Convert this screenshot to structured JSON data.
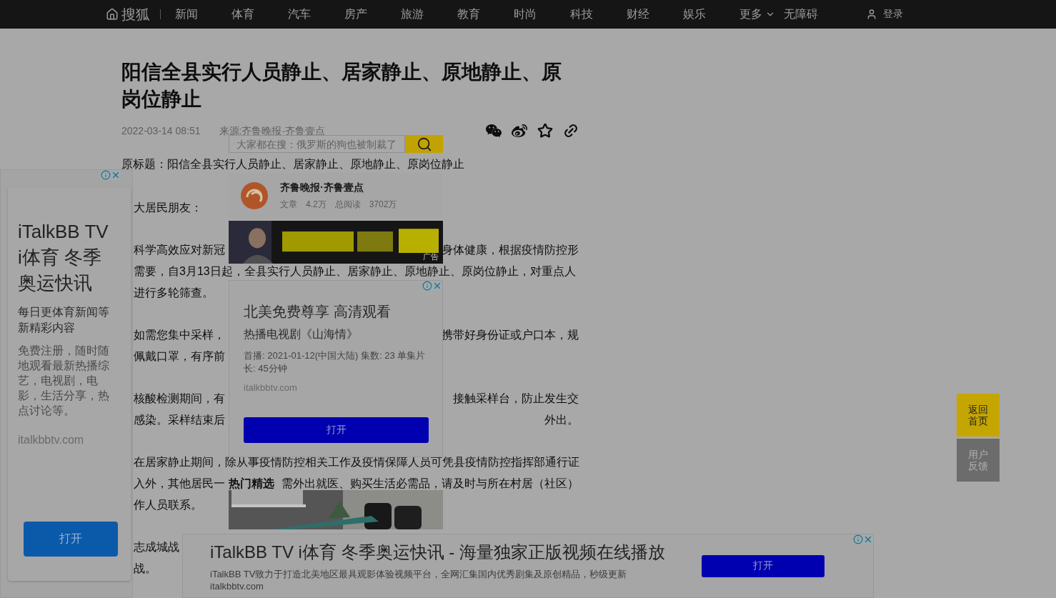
{
  "nav": {
    "logo": "搜狐",
    "items": [
      {
        "label": "新闻",
        "kind": "link"
      },
      {
        "label": "体育",
        "kind": "link"
      },
      {
        "label": "汽车",
        "kind": "link"
      },
      {
        "label": "房产",
        "kind": "link"
      },
      {
        "label": "旅游",
        "kind": "link"
      },
      {
        "label": "教育",
        "kind": "link"
      },
      {
        "label": "时尚",
        "kind": "link"
      },
      {
        "label": "科技",
        "kind": "link"
      },
      {
        "label": "财经",
        "kind": "link"
      },
      {
        "label": "娱乐",
        "kind": "link"
      },
      {
        "label": "更多",
        "kind": "dropdown"
      },
      {
        "label": "无障碍",
        "kind": "link"
      }
    ],
    "login": "登录"
  },
  "article": {
    "title": "阳信全县实行人员静止、居家静止、原地静止、原岗位静止",
    "date": "2022-03-14 08:51",
    "source": "来源:齐鲁晚报·齐鲁壹点",
    "intro": "原标题：阳信全县实行人员静止、居家静止、原地静止、原岗位静止",
    "paragraphs": [
      {
        "lines": [
          {
            "left": "大居民朋友："
          }
        ]
      },
      {
        "lines": [
          {
            "left": "科学高效应对新冠",
            "right": "身体健康，根据疫情防控形"
          },
          {
            "left": "需要，自3月13日起，全县实行人员静止、居家静止、原地静止、原岗位静止，对重点人"
          },
          {
            "left": "进行多轮筛查。"
          }
        ]
      },
      {
        "lines": [
          {
            "left": "如需您集中采样，",
            "right": "携带好身份证或户口本，规"
          },
          {
            "left": "佩戴口罩，有序前"
          }
        ]
      },
      {
        "lines": [
          {
            "left": "核酸检测期间，有",
            "right": "接触采样台，防止发生交"
          },
          {
            "left": "感染。采样结束后",
            "right": "外出。"
          }
        ]
      },
      {
        "lines": [
          {
            "left": "在居家静止期间，除从事疫情防控相关工作及疫情保障人员可凭县疫情防控指挥部通行证"
          },
          {
            "left": "入外，其他居民一",
            "right": "需外出就医、购买生活必需品，请及时与所在村居（社区）"
          },
          {
            "left": "作人员联系。"
          }
        ]
      },
      {
        "lines": [
          {
            "left": "志成城战"
          },
          {
            "left": "战。"
          }
        ]
      }
    ]
  },
  "search": {
    "placeholder": "大家都在搜：俄罗斯的狗也被制裁了"
  },
  "source_card": {
    "name": "齐鲁晚报·齐鲁壹点",
    "stats": [
      {
        "label": "文章",
        "value": "4.2万"
      },
      {
        "label": "总阅读",
        "value": "3702万"
      }
    ]
  },
  "banner": {
    "kind": "picture",
    "label": "广告"
  },
  "middle_ad": {
    "title": "北美免费尊享 高清观看",
    "subtitle": "热播电视剧《山海情》",
    "details": "首播: 2021-01-12(中国大陆) 集数: 23 单集片长: 45分钟",
    "domain": "italkbbtv.com",
    "button": "打开"
  },
  "hot": {
    "heading": "热门精选"
  },
  "left_ad": {
    "title": "iTalkBB TV i体育 冬季奥运快讯",
    "subtitle": "每日更体育新闻等新精彩内容",
    "body": "免费注册，随时随地观看最新热播综艺，电视剧，电影，生活分享，热点讨论等。",
    "domain": "italkbbtv.com",
    "button": "打开"
  },
  "bottom_ad": {
    "title": "iTalkBB TV i体育 冬季奥运快讯 - 海量独家正版视频在线播放",
    "description": "iTalkBB TV致力于打造北美地区最具观影体验视频平台，全网汇集国内优秀剧集及原创精品，秒级更新",
    "domain": "italkbbtv.com",
    "button": "打开"
  },
  "side_buttons": [
    {
      "label": "返回首页",
      "kind": "primary"
    },
    {
      "label": "用户反馈",
      "kind": "secondary"
    }
  ]
}
